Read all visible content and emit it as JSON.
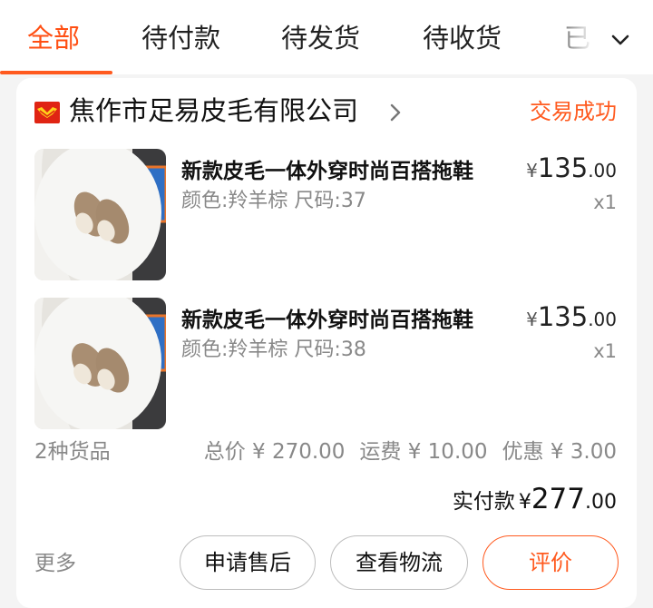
{
  "tabs": [
    {
      "label": "全部",
      "active": true
    },
    {
      "label": "待付款",
      "active": false
    },
    {
      "label": "待发货",
      "active": false
    },
    {
      "label": "待收货",
      "active": false
    },
    {
      "label": "已",
      "active": false
    }
  ],
  "order": {
    "shop_name": "焦作市足易皮毛有限公司",
    "status": "交易成功",
    "items": [
      {
        "title": "新款皮毛一体外穿时尚百搭拖鞋",
        "sku": "颜色:羚羊棕 尺码:37",
        "currency": "¥",
        "price_int": "135",
        "price_dec": ".00",
        "quantity": "x1"
      },
      {
        "title": "新款皮毛一体外穿时尚百搭拖鞋",
        "sku": "颜色:羚羊棕 尺码:38",
        "currency": "¥",
        "price_int": "135",
        "price_dec": ".00",
        "quantity": "x1"
      }
    ],
    "summary": {
      "item_count": "2种货品",
      "total": "总价 ¥ 270.00",
      "shipping": "运费 ¥ 10.00",
      "discount": "优惠 ¥ 3.00"
    },
    "paid": {
      "label": "实付款",
      "currency": "¥",
      "amount_int": "277",
      "amount_dec": ".00"
    },
    "actions": {
      "more": "更多",
      "after_sale": "申请售后",
      "logistics": "查看物流",
      "review": "评价"
    }
  },
  "colors": {
    "accent": "#ff5a1f",
    "shop_logo": "#e02413",
    "secondary_text": "#888888"
  },
  "icons": {
    "shop": "shop-logo-icon",
    "shop_arrow": "chevron-right-icon",
    "tabs_more": "chevron-down-icon"
  }
}
